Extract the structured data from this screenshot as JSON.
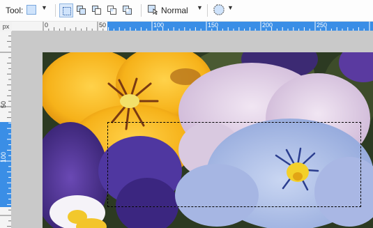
{
  "toolbar": {
    "tool_label": "Tool:",
    "tool_icon": "rectangle-select-icon",
    "selection_modes": [
      "replace-mode-icon",
      "union-mode-icon",
      "exclude-mode-icon",
      "intersect-mode-icon",
      "invert-mode-icon"
    ],
    "blend_icon": "selection-blend-icon",
    "blend_mode": "Normal",
    "shape_icon": "ellipse-shape-icon",
    "dropdown_glyph": "▼"
  },
  "ruler": {
    "unit": "px",
    "h_labels": [
      "0",
      "50",
      "100",
      "150",
      "200",
      "250"
    ],
    "v_labels": [
      "50",
      "100"
    ],
    "accent": "#3a8ee6"
  },
  "canvas": {
    "image_icon": "pansy-flowers-photo"
  }
}
